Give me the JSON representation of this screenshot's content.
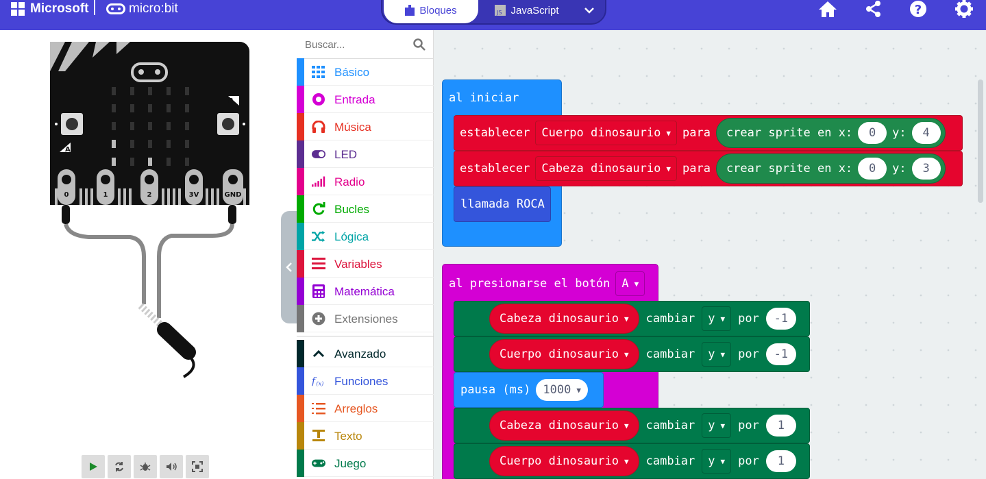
{
  "header": {
    "microsoft_label": "Microsoft",
    "microbit_label": "micro:bit",
    "tabs": [
      {
        "label": "Bloques",
        "icon": "puzzle-icon",
        "active": true
      },
      {
        "label": "JavaScript",
        "icon": "js-icon",
        "active": false
      }
    ],
    "icons": [
      "home-icon",
      "share-icon",
      "help-icon",
      "settings-icon"
    ]
  },
  "simulator": {
    "pins": [
      "0",
      "1",
      "2",
      "3V",
      "GND"
    ],
    "button_a": "A",
    "button_b": "B",
    "toolbar": [
      "play-icon",
      "restart-icon",
      "debug-icon",
      "sound-icon",
      "fullscreen-icon"
    ]
  },
  "toolbox": {
    "search_placeholder": "Buscar...",
    "categories": [
      {
        "label": "Básico",
        "color": "#1e90ff"
      },
      {
        "label": "Entrada",
        "color": "#d400d4"
      },
      {
        "label": "Música",
        "color": "#e63022"
      },
      {
        "label": "LED",
        "color": "#5c2d91"
      },
      {
        "label": "Radio",
        "color": "#e3008c"
      },
      {
        "label": "Bucles",
        "color": "#00aa00"
      },
      {
        "label": "Lógica",
        "color": "#00a4a6"
      },
      {
        "label": "Variables",
        "color": "#dc143c"
      },
      {
        "label": "Matemática",
        "color": "#9400d3"
      },
      {
        "label": "Extensiones",
        "color": "#757575"
      },
      {
        "label": "Avanzado",
        "color": "#00272b"
      },
      {
        "label": "Funciones",
        "color": "#3455db"
      },
      {
        "label": "Arreglos",
        "color": "#e65722"
      },
      {
        "label": "Texto",
        "color": "#b8860b"
      },
      {
        "label": "Juego",
        "color": "#007a4b"
      }
    ]
  },
  "workspace": {
    "on_start": {
      "hat": "al iniciar",
      "set1": {
        "kw": "establecer",
        "var": "Cuerpo dinosaurio",
        "para": "para",
        "sprite": "crear sprite en x:",
        "x": "0",
        "ylabel": "y:",
        "y": "4"
      },
      "set2": {
        "kw": "establecer",
        "var": "Cabeza dinosaurio",
        "para": "para",
        "sprite": "crear sprite en x:",
        "x": "0",
        "ylabel": "y:",
        "y": "3"
      },
      "call": "llamada ROCA"
    },
    "on_button": {
      "hat": "al presionarse el botón",
      "button": "A",
      "rows": [
        {
          "var": "Cabeza dinosaurio",
          "cambiar": "cambiar",
          "prop": "y",
          "por": "por",
          "val": "-1"
        },
        {
          "var": "Cuerpo dinosaurio",
          "cambiar": "cambiar",
          "prop": "y",
          "por": "por",
          "val": "-1"
        }
      ],
      "pause": {
        "label": "pausa (ms)",
        "val": "1000"
      },
      "rows2": [
        {
          "var": "Cabeza dinosaurio",
          "cambiar": "cambiar",
          "prop": "y",
          "por": "por",
          "val": "1"
        },
        {
          "var": "Cuerpo dinosaurio",
          "cambiar": "cambiar",
          "prop": "y",
          "por": "por",
          "val": "1"
        }
      ]
    }
  }
}
